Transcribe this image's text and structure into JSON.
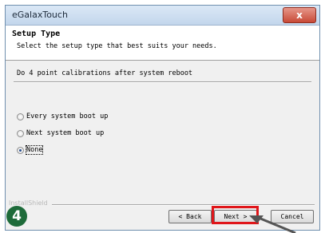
{
  "window": {
    "title": "eGalaxTouch",
    "close_glyph": "x"
  },
  "header": {
    "title": "Setup Type",
    "subtitle": "Select the setup type that best suits your needs."
  },
  "question": "Do 4 point calibrations after system reboot",
  "options": [
    {
      "label": "Every system boot up",
      "checked": false
    },
    {
      "label": "Next system boot up",
      "checked": false
    },
    {
      "label": "None",
      "checked": true
    }
  ],
  "footer": {
    "installshield": "InstallShield",
    "back_label": "< Back",
    "next_label": "Next >",
    "cancel_label": "Cancel"
  },
  "annotation": {
    "step_number": "4",
    "highlight_color": "#e0161a",
    "badge_color": "#1e6b3a"
  },
  "icons": {
    "close": "close-icon",
    "pointer": "arrow-pointer-icon"
  }
}
